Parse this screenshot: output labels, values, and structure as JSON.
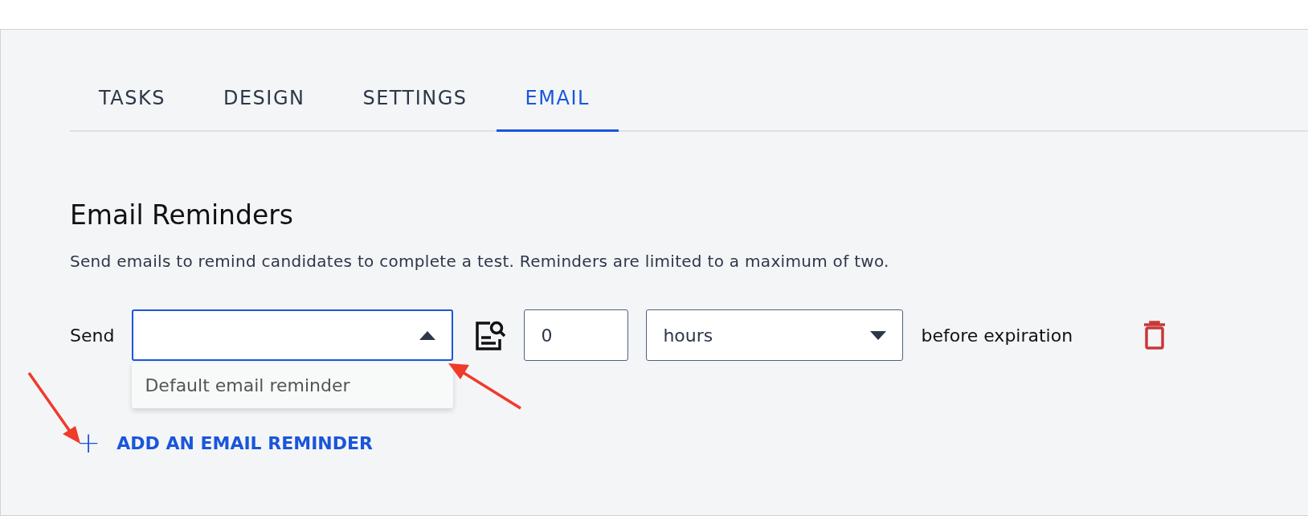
{
  "tabs": [
    {
      "label": "TASKS",
      "selected": false
    },
    {
      "label": "DESIGN",
      "selected": false
    },
    {
      "label": "SETTINGS",
      "selected": false
    },
    {
      "label": "EMAIL",
      "selected": true
    }
  ],
  "section": {
    "title": "Email Reminders",
    "description": "Send emails to remind candidates to complete a test. Reminders are limited to a maximum of two."
  },
  "reminder": {
    "send_label": "Send",
    "template_select": {
      "expanded": true,
      "options": [
        "Default email reminder"
      ]
    },
    "amount": "0",
    "unit": "hours",
    "suffix": "before expiration"
  },
  "add_button": {
    "icon": "+",
    "label": "ADD AN EMAIL REMINDER"
  }
}
